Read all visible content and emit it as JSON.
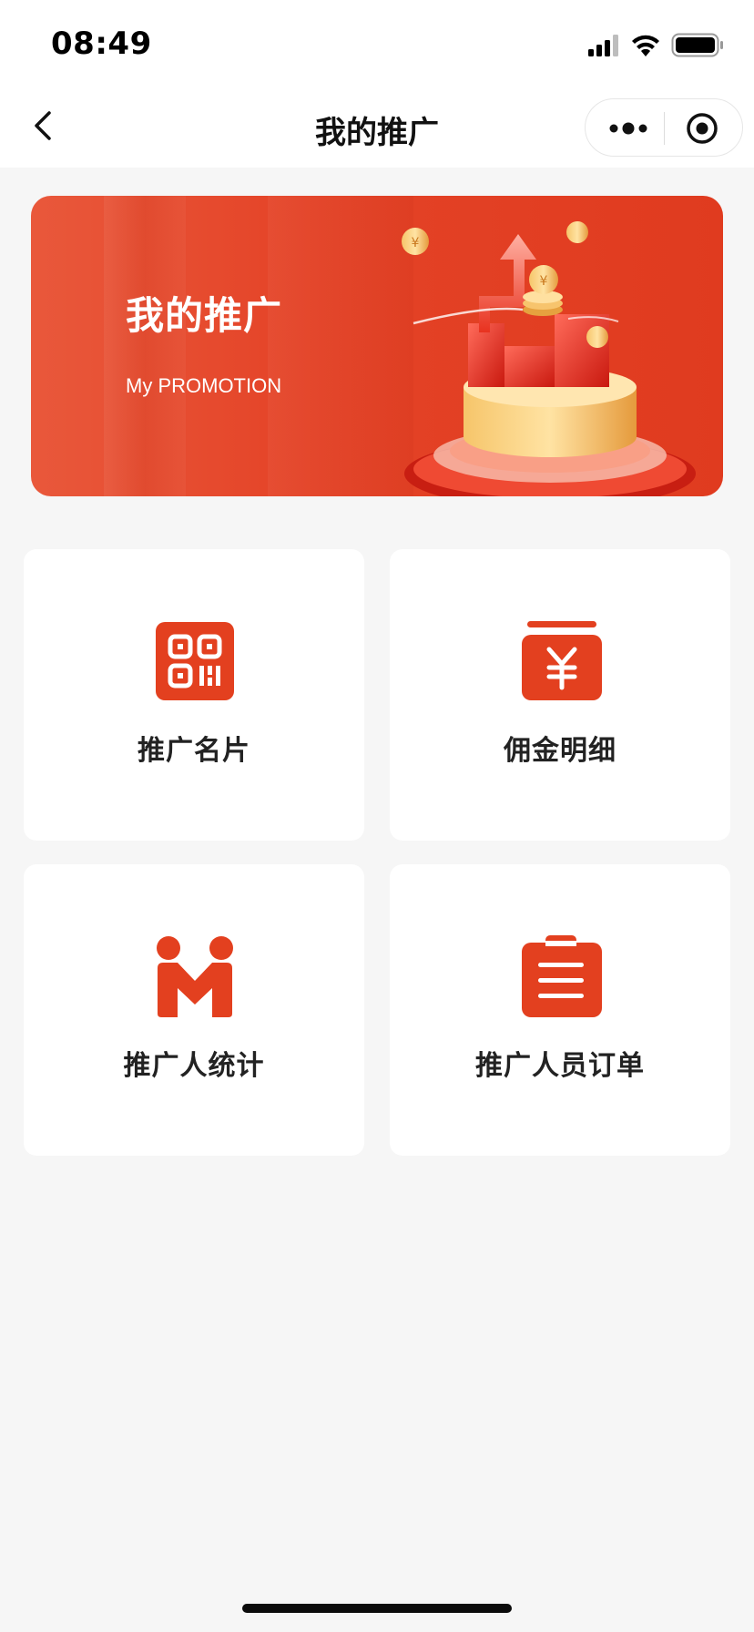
{
  "status_bar": {
    "time": "08:49",
    "icons": [
      "signal-icon",
      "wifi-icon",
      "battery-icon"
    ]
  },
  "nav": {
    "title": "我的推广",
    "back_icon": "chevron-left-icon",
    "more_icon": "more-dots-icon",
    "close_icon": "target-icon"
  },
  "banner": {
    "title": "我的推广",
    "subtitle": "My PROMOTION"
  },
  "menu": {
    "items": [
      {
        "label": "推广名片",
        "icon": "qr-code-icon"
      },
      {
        "label": "佣金明细",
        "icon": "yuan-wallet-icon"
      },
      {
        "label": "推广人统计",
        "icon": "people-handshake-icon"
      },
      {
        "label": "推广人员订单",
        "icon": "clipboard-icon"
      }
    ]
  },
  "colors": {
    "accent": "#e3401f",
    "background": "#f6f6f6",
    "card": "#ffffff"
  }
}
